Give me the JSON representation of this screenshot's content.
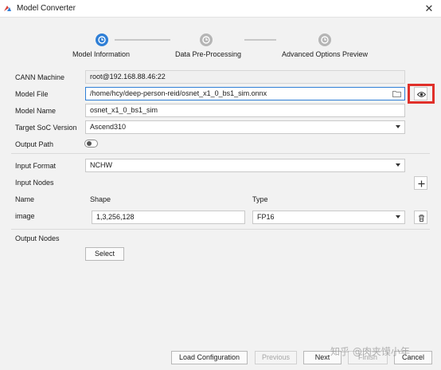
{
  "window": {
    "title": "Model Converter"
  },
  "stepper": {
    "steps": [
      {
        "label": "Model Information",
        "state": "active"
      },
      {
        "label": "Data Pre-Processing",
        "state": "inactive"
      },
      {
        "label": "Advanced Options  Preview",
        "state": "inactive"
      }
    ]
  },
  "form": {
    "cann_machine": {
      "label": "CANN Machine",
      "value": "root@192.168.88.46:22"
    },
    "model_file": {
      "label": "Model File",
      "value": "/home/hcy/deep-person-reid/osnet_x1_0_bs1_sim.onnx"
    },
    "model_name": {
      "label": "Model Name",
      "value": "osnet_x1_0_bs1_sim"
    },
    "target_soc": {
      "label": "Target SoC Version",
      "value": "Ascend310"
    },
    "output_path": {
      "label": "Output Path"
    },
    "input_format": {
      "label": "Input Format",
      "value": "NCHW"
    },
    "input_nodes": {
      "label": "Input Nodes",
      "headers": {
        "name": "Name",
        "shape": "Shape",
        "type": "Type"
      },
      "rows": [
        {
          "name": "image",
          "shape": "1,3,256,128",
          "type": "FP16"
        }
      ]
    },
    "output_nodes": {
      "label": "Output Nodes",
      "select_label": "Select"
    }
  },
  "footer": {
    "load_configuration": "Load Configuration",
    "previous": "Previous",
    "next": "Next",
    "finish": "Finish",
    "cancel": "Cancel"
  },
  "watermark": "知乎 @肉夹馍小年",
  "colors": {
    "accent": "#2f7fd6",
    "highlight": "#e0302a"
  }
}
